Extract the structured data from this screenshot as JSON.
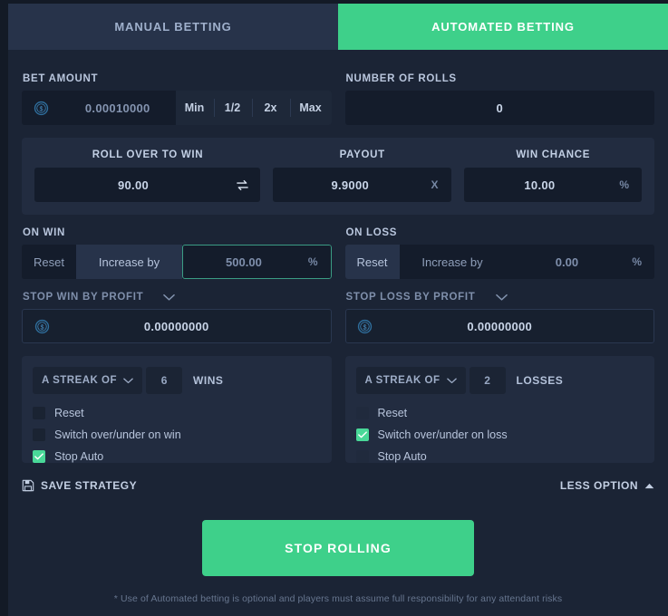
{
  "tabs": [
    {
      "label": "MANUAL BETTING",
      "active": false
    },
    {
      "label": "AUTOMATED BETTING",
      "active": true
    }
  ],
  "bet_amount": {
    "label": "BET AMOUNT",
    "value": "0.00010000",
    "currency_icon": "coin-dollar-icon",
    "quick_buttons": [
      "Min",
      "1/2",
      "2x",
      "Max"
    ]
  },
  "number_of_rolls": {
    "label": "NUMBER OF ROLLS",
    "value": "0"
  },
  "bet_card": {
    "roll_over": {
      "label": "ROLL OVER TO WIN",
      "value": "90.00",
      "swap_icon": "swap-arrows-icon"
    },
    "payout": {
      "label": "PAYOUT",
      "value": "9.9000",
      "suffix": "X"
    },
    "win_chance": {
      "label": "WIN CHANCE",
      "value": "10.00",
      "suffix": "%"
    }
  },
  "on_win": {
    "label": "ON WIN",
    "reset_label": "Reset",
    "increase_label": "Increase by",
    "selected": "increase",
    "value": "500.00",
    "suffix": "%"
  },
  "on_loss": {
    "label": "ON LOSS",
    "reset_label": "Reset",
    "increase_label": "Increase by",
    "selected": "reset",
    "value": "0.00",
    "suffix": "%"
  },
  "stop_win": {
    "label": "STOP WIN BY PROFIT",
    "chevron": "chevron-down-icon",
    "currency_icon": "coin-dollar-icon",
    "value": "0.00000000"
  },
  "stop_loss": {
    "label": "STOP LOSS BY PROFIT",
    "chevron": "chevron-down-icon",
    "currency_icon": "coin-dollar-icon",
    "value": "0.00000000"
  },
  "win_streak": {
    "select_label": "A STREAK OF",
    "chevron": "chevron-down-icon",
    "count": "6",
    "unit": "WINS",
    "options": [
      {
        "label": "Reset",
        "checked": false
      },
      {
        "label": "Switch over/under on win",
        "checked": false
      },
      {
        "label": "Stop Auto",
        "checked": true
      }
    ]
  },
  "loss_streak": {
    "select_label": "A STREAK OF",
    "chevron": "chevron-down-icon",
    "count": "2",
    "unit": "LOSSES",
    "options": [
      {
        "label": "Reset",
        "checked": false
      },
      {
        "label": "Switch over/under on loss",
        "checked": true
      },
      {
        "label": "Stop Auto",
        "checked": false
      }
    ]
  },
  "footer": {
    "save_strategy_label": "SAVE STRATEGY",
    "save_icon": "floppy-save-icon",
    "less_option_label": "LESS OPTION",
    "less_option_icon": "chevron-up-icon"
  },
  "roll_button": {
    "label": "STOP ROLLING"
  },
  "disclaimer": "* Use of Automated betting is optional and players must assume full responsibility for any attendant risks",
  "colors": {
    "accent_green": "#3ed08a",
    "check_green": "#49d898",
    "panel_bg": "#1b2435",
    "card_bg": "#222c40",
    "input_bg": "#141c2b",
    "page_bg": "#131a26",
    "focus_border": "#3b9c84"
  }
}
